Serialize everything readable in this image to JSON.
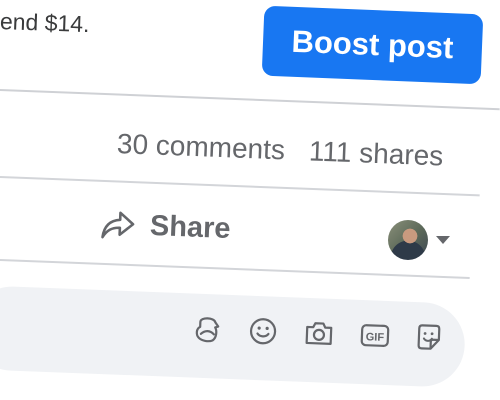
{
  "promo": {
    "text": "end $14."
  },
  "boost": {
    "label": "Boost post"
  },
  "stats": {
    "comments": "30 comments",
    "shares": "111 shares"
  },
  "actions": {
    "share_label": "Share"
  },
  "comment_box": {
    "placeholder": ""
  },
  "icons": {
    "share": "share-arrow-icon",
    "avatar_caret": "chevron-down-icon",
    "tools": [
      "avatar-sticker-icon",
      "emoji-icon",
      "camera-icon",
      "gif-icon",
      "sticker-icon"
    ]
  },
  "colors": {
    "accent": "#1877f2",
    "muted_text": "#65676b",
    "divider": "#cfd1d5",
    "comment_bg": "#f0f2f5"
  }
}
